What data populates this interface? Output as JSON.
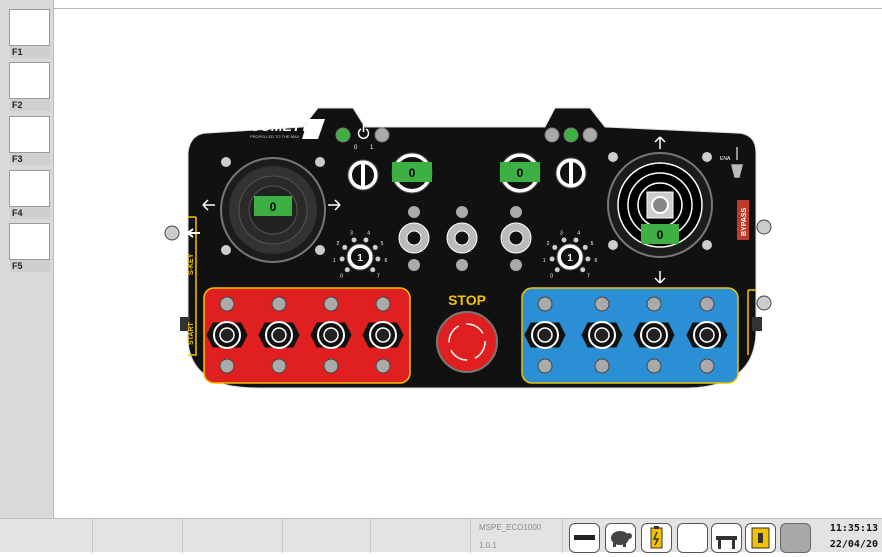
{
  "sidebar": {
    "function_keys": [
      {
        "label": "F1"
      },
      {
        "label": "F2"
      },
      {
        "label": "F3"
      },
      {
        "label": "F4"
      },
      {
        "label": "F5"
      }
    ]
  },
  "panel": {
    "brand_logo": "COMETTO",
    "brand_tagline": "PROPELLED TO THE MAX",
    "manufacturer_logo": "autec",
    "left_joystick_value": "0",
    "right_joystick_value": "0",
    "left_knob_value": "0",
    "right_knob_value": "0",
    "left_switch_positions": [
      "0",
      "1"
    ],
    "stop_label": "STOP",
    "side_labels": {
      "skey": "S-KEY",
      "start": "START",
      "bypass": "BYPASS",
      "ena": "ENA"
    },
    "selector_left_value": "1",
    "selector_right_value": "1",
    "selector_numbers": [
      "0",
      "1",
      "2",
      "3",
      "4",
      "5",
      "6",
      "7"
    ],
    "colors": {
      "body": "#111111",
      "green_indicator": "#3cb043",
      "red_group": "#e02020",
      "blue_group": "#2b8fd6",
      "yellow_accent": "#f2c200"
    }
  },
  "statusbar": {
    "model_name": "MSPE_ECO1000",
    "version": "1.0.1",
    "time": "11:35:13",
    "date": "22/04/20",
    "icons": [
      "minus-icon",
      "turtle-icon",
      "battery-icon",
      "blank-icon",
      "machine-icon",
      "pump-icon",
      "gray-icon"
    ]
  }
}
